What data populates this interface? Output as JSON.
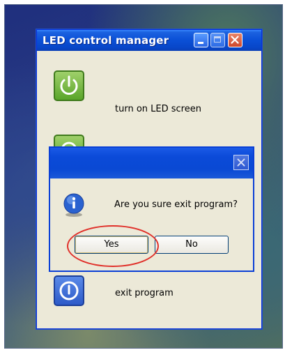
{
  "window": {
    "title": "LED control manager",
    "buttons": [
      "minimize",
      "maximize",
      "close"
    ]
  },
  "items": [
    {
      "label": "turn on LED screen",
      "icon": "power-icon",
      "color": "#5aa52a"
    },
    {
      "label": "",
      "icon": "app-icon",
      "color": "#5aa52a"
    },
    {
      "label": "exit program",
      "icon": "power-icon",
      "color": "#2d5ac8"
    }
  ],
  "dialog": {
    "message": "Are you sure exit program?",
    "icon": "info-icon",
    "yes_label": "Yes",
    "no_label": "No"
  },
  "annotation": {
    "type": "highlight-circle",
    "target": "yes-button",
    "color": "#e0302a"
  }
}
